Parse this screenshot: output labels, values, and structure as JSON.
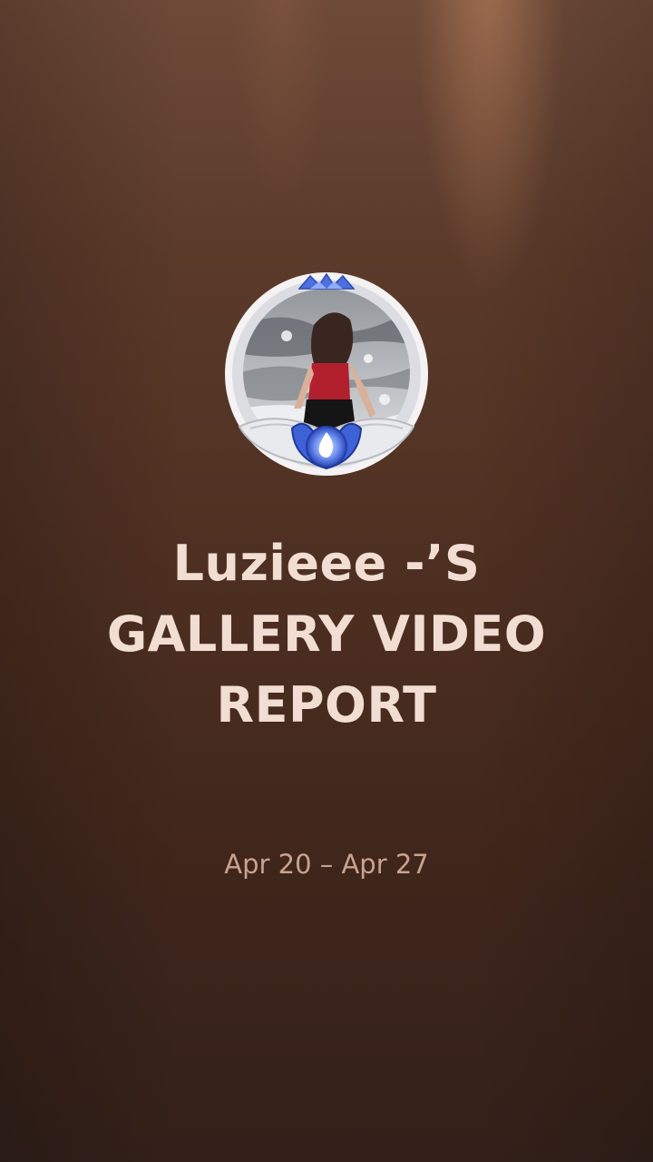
{
  "report": {
    "username_line": "Luzieee -’S",
    "title_line_2": "GALLERY VIDEO",
    "title_line_3": "REPORT",
    "date_range": "Apr 20 – Apr 27"
  },
  "avatar": {
    "frame_icon": "blue-flame-lotus-icon",
    "crown_icon": "blue-crown-icon"
  },
  "colors": {
    "background_top": "#6e4a38",
    "background_bottom": "#33201a",
    "title_text": "#f1ddd2",
    "date_text": "#c9a38f",
    "badge_blue": "#3d62d8"
  }
}
